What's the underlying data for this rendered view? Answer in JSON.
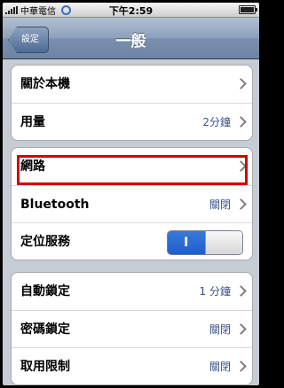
{
  "status": {
    "carrier": "中華電信",
    "time": "下午2:59"
  },
  "nav": {
    "back_label": "設定",
    "title": "一般"
  },
  "groups": [
    {
      "rows": [
        {
          "label": "關於本機",
          "value": ""
        },
        {
          "label": "用量",
          "value": "2分鐘"
        }
      ]
    },
    {
      "rows": [
        {
          "label": "網路",
          "value": ""
        },
        {
          "label": "Bluetooth",
          "value": "關閉"
        },
        {
          "label": "定位服務",
          "toggle": "I",
          "toggle_state": "on"
        }
      ]
    },
    {
      "rows": [
        {
          "label": "自動鎖定",
          "value": "1 分鐘"
        },
        {
          "label": "密碼鎖定",
          "value": "關閉"
        },
        {
          "label": "取用限制",
          "value": "關閉"
        }
      ]
    }
  ],
  "colors": {
    "highlight": "#d40000",
    "value_text": "#385487",
    "toggle_on": "#1f5fcc"
  }
}
